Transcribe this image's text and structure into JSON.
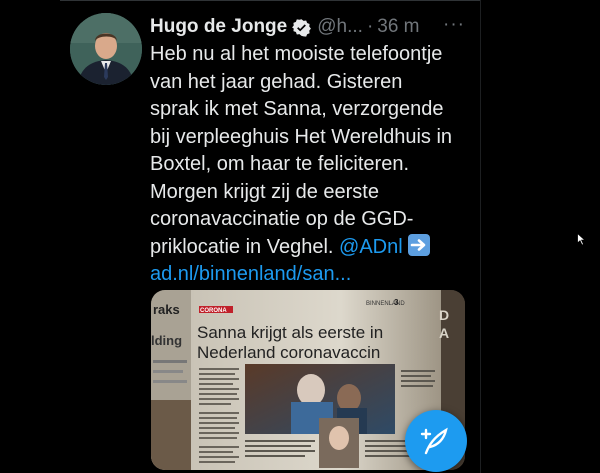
{
  "tweet": {
    "author_name": "Hugo de Jonge",
    "author_handle": "@h...",
    "separator": "·",
    "time_ago": "36 m",
    "more_label": "···",
    "text_line1": "Heb nu al het mooiste telefoontje",
    "text_line2": "van het jaar gehad. Gisteren",
    "text_line3": "sprak ik met Sanna, verzorgende",
    "text_line4": "bij verpleeghuis Het Wereldhuis in",
    "text_line5": "Boxtel, om haar te feliciteren.",
    "text_line6": "Morgen krijgt zij de eerste",
    "text_line7": "coronavaccinatie op de GGD-",
    "text_line8": "priklocatie in Veghel.",
    "mention": "@ADnl",
    "url": "ad.nl/binnenland/san..."
  },
  "media": {
    "newspaper_section_left": "raks",
    "newspaper_section_left2": "lding",
    "newspaper_kicker": "CORONA",
    "newspaper_headline_line1": "Sanna krijgt als eerste in",
    "newspaper_headline_line2": "Nederland coronavaccin",
    "newspaper_section": "BINNENLAND",
    "newspaper_page": "3"
  },
  "icons": {
    "verified": "verified-badge-icon",
    "arrow": "right-arrow-emoji-icon",
    "compose": "compose-tweet-icon",
    "cursor": "mouse-pointer-icon"
  },
  "colors": {
    "background": "#000000",
    "text": "#e7e9ea",
    "muted": "#71767b",
    "accent": "#1d9bf0"
  }
}
